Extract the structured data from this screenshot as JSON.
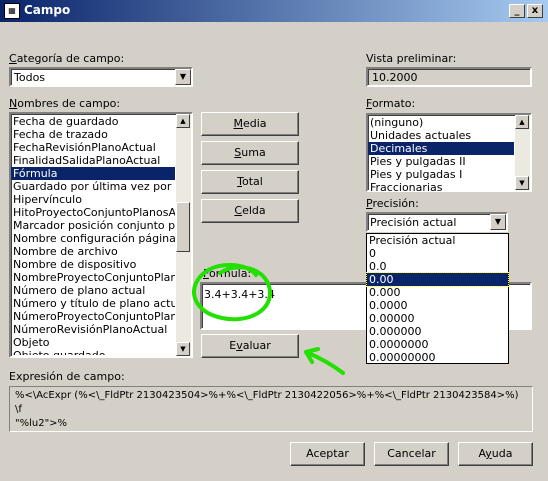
{
  "window": {
    "title": "Campo",
    "minimize": "_",
    "close": "x"
  },
  "categoria": {
    "label_u": "C",
    "label_rest": "ategoría de campo:",
    "value": "Todos"
  },
  "nombres": {
    "label_u": "N",
    "label_rest": "ombres de campo:",
    "items": [
      "Fecha de guardado",
      "Fecha de trazado",
      "FechaRevisiónPlanoActual",
      "FinalidadSalidaPlanoActual",
      "Fórmula",
      "Guardado por última vez por",
      "Hipervínculo",
      "HitoProyectoConjuntoPlanosActual",
      "Marcador posición conjunto planos",
      "Nombre configuración página",
      "Nombre de archivo",
      "Nombre de dispositivo",
      "NombreProyectoConjuntoPlanosActual",
      "Número de plano actual",
      "Número y título de plano actual",
      "NúmeroProyectoConjuntoPlanosActual",
      "NúmeroRevisiónPlanoActual",
      "Objeto",
      "Objeto guardado"
    ],
    "selected_index": 4
  },
  "buttons": {
    "media_u": "M",
    "media_rest": "edia",
    "suma_u": "S",
    "suma_rest": "uma",
    "total_u": "T",
    "total_rest": "otal",
    "celda_u": "C",
    "celda_rest": "elda",
    "evaluar_pre": "E",
    "evaluar_u": "v",
    "evaluar_rest": "aluar",
    "aceptar": "Aceptar",
    "cancelar": "Cancelar",
    "ayuda_pre": "A",
    "ayuda_u": "y",
    "ayuda_rest": "uda"
  },
  "formula": {
    "label_u": "F",
    "label_rest": "ormula:",
    "value": "3.4+3.4+3.4"
  },
  "vista": {
    "label": "Vista preliminar:",
    "value": "10.2000"
  },
  "formato": {
    "label_u": "F",
    "label_rest": "ormato:",
    "items": [
      "(ninguno)",
      "Unidades actuales",
      "Decimales",
      "Pies y pulgadas II",
      "Pies y pulgadas I",
      "Fraccionarias"
    ],
    "selected_index": 2
  },
  "precision": {
    "label_u": "P",
    "label_rest": "recisión:",
    "value": "Precisión actual",
    "options": [
      "Precisión actual",
      "0",
      "0.0",
      "0.00",
      "0.000",
      "0.0000",
      "0.00000",
      "0.000000",
      "0.0000000",
      "0.00000000"
    ],
    "selected_index": 3
  },
  "expresion": {
    "label": "Expresión de campo:",
    "line1": "%<\\AcExpr (%<\\_FldPtr 2130423504>%+%<\\_FldPtr 2130422056>%+%<\\_FldPtr 2130423584>%) \\f",
    "line2": "\"%lu2\">%"
  },
  "annotation": {
    "color": "#22e000"
  }
}
